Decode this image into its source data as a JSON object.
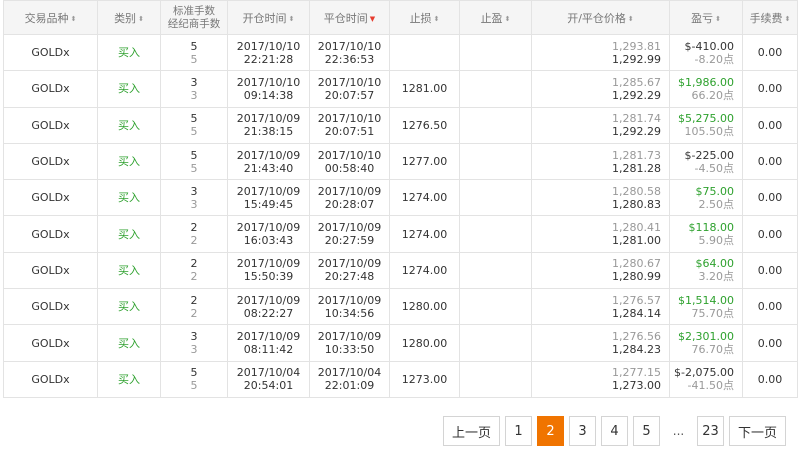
{
  "table": {
    "headers": {
      "symbol": "交易品种",
      "type": "类别",
      "lots_line1": "标准手数",
      "lots_line2": "经纪商手数",
      "open_time": "开仓时间",
      "close_time": "平仓时间",
      "stop_loss": "止损",
      "take_profit": "止盈",
      "price": "开/平仓价格",
      "profit": "盈亏",
      "fee": "手续费"
    },
    "sort_icons": {
      "both": "⬍",
      "active_desc": "▼"
    },
    "rows": [
      {
        "symbol": "GOLDx",
        "type": "买入",
        "std_lots": "5",
        "broker_lots": "5",
        "open_date": "2017/10/10",
        "open_time": "22:21:28",
        "close_date": "2017/10/10",
        "close_time": "22:36:53",
        "stop_loss": "",
        "take_profit": "",
        "open_price": "1,293.81",
        "close_price": "1,292.99",
        "profit": "$-410.00",
        "points": "-8.20点",
        "fee": "0.00",
        "profit_positive": false
      },
      {
        "symbol": "GOLDx",
        "type": "买入",
        "std_lots": "3",
        "broker_lots": "3",
        "open_date": "2017/10/10",
        "open_time": "09:14:38",
        "close_date": "2017/10/10",
        "close_time": "20:07:57",
        "stop_loss": "1281.00",
        "take_profit": "",
        "open_price": "1,285.67",
        "close_price": "1,292.29",
        "profit": "$1,986.00",
        "points": "66.20点",
        "fee": "0.00",
        "profit_positive": true
      },
      {
        "symbol": "GOLDx",
        "type": "买入",
        "std_lots": "5",
        "broker_lots": "5",
        "open_date": "2017/10/09",
        "open_time": "21:38:15",
        "close_date": "2017/10/10",
        "close_time": "20:07:51",
        "stop_loss": "1276.50",
        "take_profit": "",
        "open_price": "1,281.74",
        "close_price": "1,292.29",
        "profit": "$5,275.00",
        "points": "105.50点",
        "fee": "0.00",
        "profit_positive": true
      },
      {
        "symbol": "GOLDx",
        "type": "买入",
        "std_lots": "5",
        "broker_lots": "5",
        "open_date": "2017/10/09",
        "open_time": "21:43:40",
        "close_date": "2017/10/10",
        "close_time": "00:58:40",
        "stop_loss": "1277.00",
        "take_profit": "",
        "open_price": "1,281.73",
        "close_price": "1,281.28",
        "profit": "$-225.00",
        "points": "-4.50点",
        "fee": "0.00",
        "profit_positive": false
      },
      {
        "symbol": "GOLDx",
        "type": "买入",
        "std_lots": "3",
        "broker_lots": "3",
        "open_date": "2017/10/09",
        "open_time": "15:49:45",
        "close_date": "2017/10/09",
        "close_time": "20:28:07",
        "stop_loss": "1274.00",
        "take_profit": "",
        "open_price": "1,280.58",
        "close_price": "1,280.83",
        "profit": "$75.00",
        "points": "2.50点",
        "fee": "0.00",
        "profit_positive": true
      },
      {
        "symbol": "GOLDx",
        "type": "买入",
        "std_lots": "2",
        "broker_lots": "2",
        "open_date": "2017/10/09",
        "open_time": "16:03:43",
        "close_date": "2017/10/09",
        "close_time": "20:27:59",
        "stop_loss": "1274.00",
        "take_profit": "",
        "open_price": "1,280.41",
        "close_price": "1,281.00",
        "profit": "$118.00",
        "points": "5.90点",
        "fee": "0.00",
        "profit_positive": true
      },
      {
        "symbol": "GOLDx",
        "type": "买入",
        "std_lots": "2",
        "broker_lots": "2",
        "open_date": "2017/10/09",
        "open_time": "15:50:39",
        "close_date": "2017/10/09",
        "close_time": "20:27:48",
        "stop_loss": "1274.00",
        "take_profit": "",
        "open_price": "1,280.67",
        "close_price": "1,280.99",
        "profit": "$64.00",
        "points": "3.20点",
        "fee": "0.00",
        "profit_positive": true
      },
      {
        "symbol": "GOLDx",
        "type": "买入",
        "std_lots": "2",
        "broker_lots": "2",
        "open_date": "2017/10/09",
        "open_time": "08:22:27",
        "close_date": "2017/10/09",
        "close_time": "10:34:56",
        "stop_loss": "1280.00",
        "take_profit": "",
        "open_price": "1,276.57",
        "close_price": "1,284.14",
        "profit": "$1,514.00",
        "points": "75.70点",
        "fee": "0.00",
        "profit_positive": true
      },
      {
        "symbol": "GOLDx",
        "type": "买入",
        "std_lots": "3",
        "broker_lots": "3",
        "open_date": "2017/10/09",
        "open_time": "08:11:42",
        "close_date": "2017/10/09",
        "close_time": "10:33:50",
        "stop_loss": "1280.00",
        "take_profit": "",
        "open_price": "1,276.56",
        "close_price": "1,284.23",
        "profit": "$2,301.00",
        "points": "76.70点",
        "fee": "0.00",
        "profit_positive": true
      },
      {
        "symbol": "GOLDx",
        "type": "买入",
        "std_lots": "5",
        "broker_lots": "5",
        "open_date": "2017/10/04",
        "open_time": "20:54:01",
        "close_date": "2017/10/04",
        "close_time": "22:01:09",
        "stop_loss": "1273.00",
        "take_profit": "",
        "open_price": "1,277.15",
        "close_price": "1,273.00",
        "profit": "$-2,075.00",
        "points": "-41.50点",
        "fee": "0.00",
        "profit_positive": false
      }
    ]
  },
  "pagination": {
    "prev_label": "上一页",
    "next_label": "下一页",
    "ellipsis": "...",
    "pages": [
      "1",
      "2",
      "3",
      "4",
      "5"
    ],
    "last_page": "23",
    "current_page": "2"
  },
  "colors": {
    "accent": "#f07400",
    "buy": "#2ea12e",
    "profit_positive": "#2ea12e",
    "sort_active": "#e63b2e"
  }
}
